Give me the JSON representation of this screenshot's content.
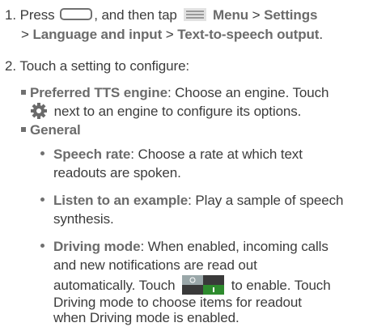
{
  "step1": {
    "number": "1.",
    "press": "Press",
    "then_tap": ", and then tap",
    "menu": "Menu",
    "sep1": " > ",
    "settings": "Settings",
    "path_prefix": "> ",
    "language_input": "Language and input",
    "sep2": " > ",
    "tts_output": "Text-to-speech output",
    "period": "."
  },
  "step2": {
    "number": "2.",
    "text": "Touch a setting to configure:"
  },
  "preferred": {
    "label": "Preferred TTS engine",
    "desc_line1": ": Choose an engine. Touch",
    "desc_line2": "next to an engine to configure its options."
  },
  "general": {
    "label": "General"
  },
  "speech_rate": {
    "label": "Speech rate",
    "line1": ": Choose a rate at which text",
    "line2": "readouts are spoken."
  },
  "listen": {
    "label": "Listen to an example",
    "line1": ": Play a sample of speech",
    "line2": "synthesis."
  },
  "driving": {
    "label": "Driving mode",
    "line1": ": When enabled, incoming calls",
    "line2": "and new notifications are read out",
    "line3_a": "automatically. Touch",
    "line3_b": "to enable. Touch",
    "line4": "Driving mode to choose items for readout",
    "line5": "when Driving mode is enabled."
  },
  "icons": {
    "home": "home-button-icon",
    "menu": "menu-icon",
    "gear": "gear-icon",
    "toggle": "toggle-switch-icon"
  },
  "colors": {
    "text": "#3c3c3c",
    "bold": "#6b6b6b",
    "toggle_on": "#2e8b2e",
    "toggle_off": "#4a4a4a"
  }
}
